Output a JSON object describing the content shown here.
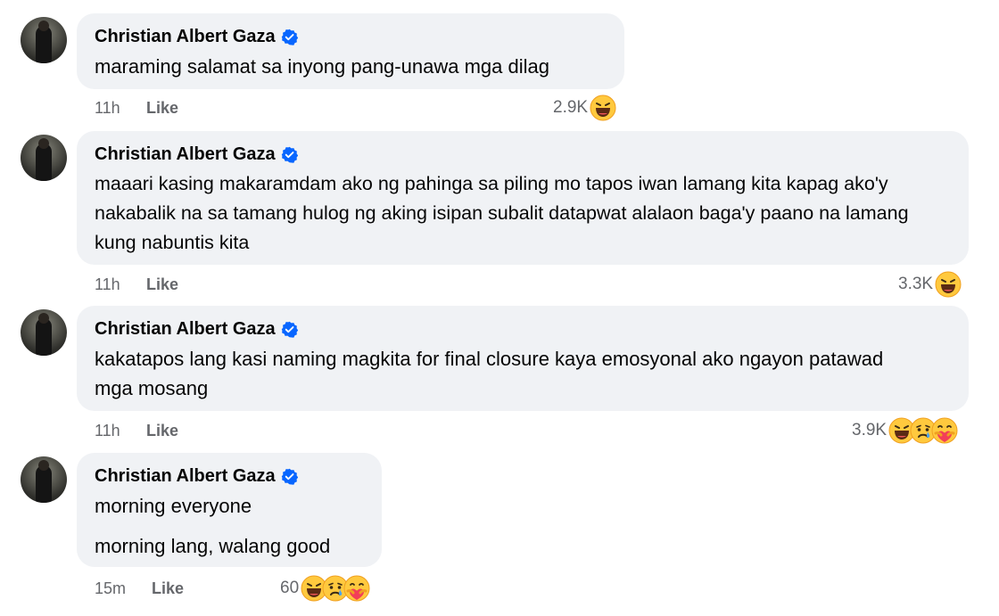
{
  "comments": [
    {
      "author": "Christian Albert Gaza",
      "lines": [
        "maraming salamat sa inyong pang-unawa mga dilag"
      ],
      "time": "11h",
      "like_label": "Like",
      "reaction_count": "2.9K",
      "reactions": [
        "haha"
      ]
    },
    {
      "author": "Christian Albert Gaza",
      "lines": [
        "maaari kasing makaramdam ako ng pahinga sa piling mo tapos iwan lamang kita kapag ako'y nakabalik na sa tamang hulog ng aking isipan subalit datapwat alalaon baga'y paano na lamang kung nabuntis kita"
      ],
      "time": "11h",
      "like_label": "Like",
      "reaction_count": "3.3K",
      "reactions": [
        "haha"
      ]
    },
    {
      "author": "Christian Albert Gaza",
      "lines": [
        "kakatapos lang kasi naming magkita for final closure kaya emosyonal ako ngayon patawad mga mosang"
      ],
      "time": "11h",
      "like_label": "Like",
      "reaction_count": "3.9K",
      "reactions": [
        "haha",
        "sad",
        "care"
      ]
    },
    {
      "author": "Christian Albert Gaza",
      "lines": [
        "morning everyone",
        "morning lang, walang good"
      ],
      "time": "15m",
      "like_label": "Like",
      "reaction_count": "60",
      "reactions": [
        "haha",
        "sad",
        "care"
      ]
    }
  ],
  "colors": {
    "bubble": "#f0f2f5",
    "verified": "#0866ff",
    "meta_text": "#65676b",
    "emoji_yellow": "#ffc93e"
  }
}
